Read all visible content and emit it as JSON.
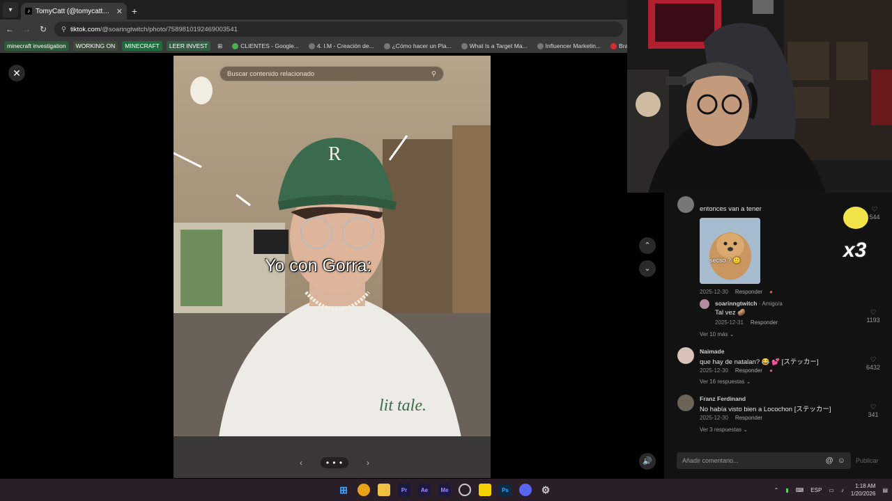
{
  "browser": {
    "tab_title": "TomyCatt (@tomycatts) | TikTok",
    "tab_icon": "tiktok-icon",
    "url_host": "tiktok.com",
    "url_path": "/@soaringtwitch/photo/7589810192469003541",
    "bookmarks": [
      {
        "label": "minecraft investigation",
        "style": "g1"
      },
      {
        "label": "WORKING ON",
        "style": "g2"
      },
      {
        "label": "MINECRAFT",
        "style": "g3"
      },
      {
        "label": "LEER INVEST",
        "style": "g4"
      }
    ],
    "bookmark_links": [
      "CLIENTES - Google...",
      "4. I.M - Creación de...",
      "¿Cómo hacer un Pla...",
      "What Is a Target Ma...",
      "Influencer Marketin...",
      "Brand Pitch Gu"
    ]
  },
  "viewer": {
    "search_placeholder": "Buscar contenido relacionado",
    "caption": "Yo con Gorra:",
    "carousel_dots": "• • •"
  },
  "comments": [
    {
      "text": "entonces van a tener",
      "image_caption": "secso ? 🙂",
      "date": "2025-12-30",
      "reply_label": "Responder",
      "likes": "544",
      "reply": {
        "user": "soarinngtwitch",
        "badge": "· Amigo/a",
        "text": "Tal vez 🥔",
        "date": "2025-12-31",
        "reply_label": "Responder",
        "likes": "1193"
      },
      "more": "Ver 10 más"
    },
    {
      "user": "Naimade",
      "text": "que hay de natalan? 😂 💕 [ステッカー]",
      "date": "2025-12-30",
      "reply_label": "Responder",
      "likes": "6432",
      "more": "Ver 16 respuestas"
    },
    {
      "user": "Franz Ferdinand",
      "text": "No había visto bien a Locochon [ステッカー]",
      "date": "2025-12-30",
      "reply_label": "Responder",
      "likes": "341",
      "more": "Ver 3 respuestas"
    }
  ],
  "comment_input": {
    "placeholder": "Añadir comentario...",
    "publish_label": "Publicar"
  },
  "overlay_multiplier": "x3",
  "taskbar": {
    "lang": "ESP",
    "time": "1:18 AM",
    "date": "1/20/2026"
  }
}
